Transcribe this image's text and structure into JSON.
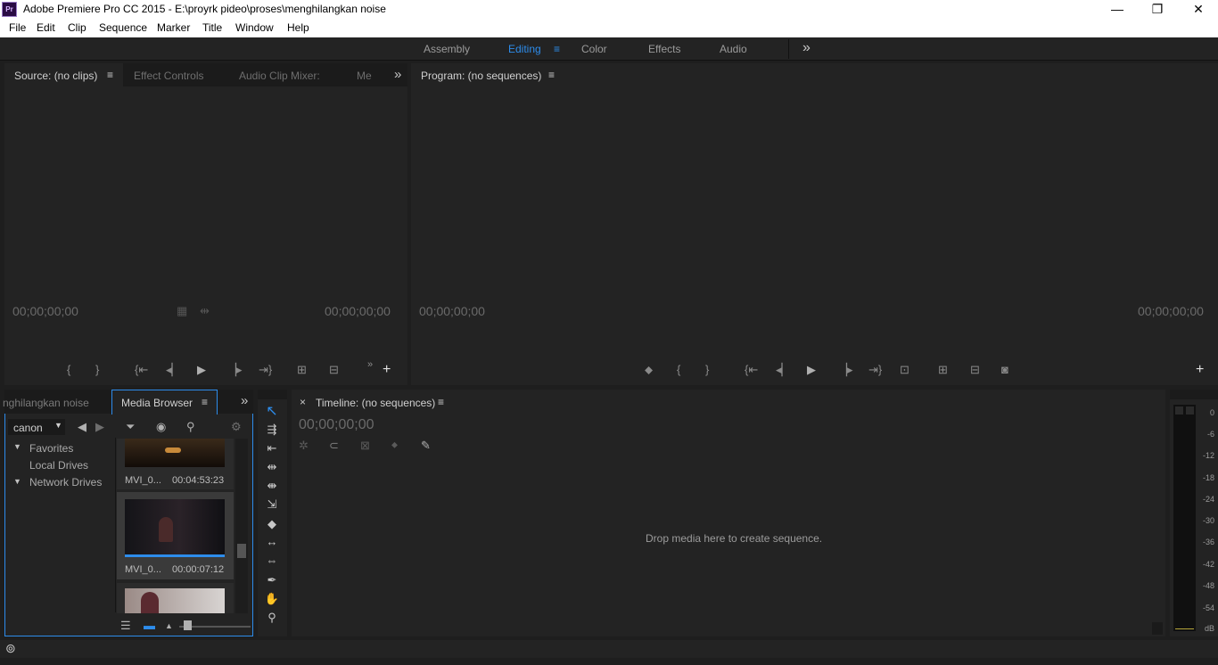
{
  "window": {
    "title": "Adobe Premiere Pro CC 2015 - E:\\proyrk pideo\\proses\\menghilangkan noise",
    "app_icon": "Pr",
    "minimize": "—",
    "maximize": "❐",
    "close": "✕"
  },
  "menu": [
    "File",
    "Edit",
    "Clip",
    "Sequence",
    "Marker",
    "Title",
    "Window",
    "Help"
  ],
  "workspaces": {
    "items": [
      "Assembly",
      "Editing",
      "Color",
      "Effects",
      "Audio"
    ],
    "active": "Editing",
    "accent": "#2d8ceb",
    "overflow": "»",
    "menu": "≡"
  },
  "source": {
    "tab": "Source: (no clips)",
    "tabs": [
      "Effect Controls",
      "Audio Clip Mixer:",
      "Me"
    ],
    "tc_left": "00;00;00;00",
    "tc_right": "00;00;00;00",
    "menu": "≡",
    "overflow": "»"
  },
  "program": {
    "tab": "Program: (no sequences)",
    "tc_left": "00;00;00;00",
    "tc_right": "00;00;00;00",
    "menu": "≡"
  },
  "project": {
    "tab_partial": "nghilangkan noise",
    "tab_media": "Media Browser",
    "menu": "≡",
    "overflow": "»",
    "location": "canon",
    "tree": [
      "Favorites",
      "Local Drives",
      "Network Drives"
    ],
    "clips": [
      {
        "name": "MVI_0...",
        "duration": "00:04:53:23"
      },
      {
        "name": "MVI_0...",
        "duration": "00:00:07:12"
      }
    ]
  },
  "timeline": {
    "tab": "Timeline: (no sequences)",
    "close": "×",
    "menu": "≡",
    "timecode": "00;00;00;00",
    "drop_text": "Drop media here to create sequence."
  },
  "meter": {
    "scale": [
      "0",
      "-6",
      "-12",
      "-18",
      "-24",
      "-30",
      "-36",
      "-42",
      "-48",
      "-54",
      "dB"
    ]
  },
  "status": {
    "icon": "⊚"
  }
}
